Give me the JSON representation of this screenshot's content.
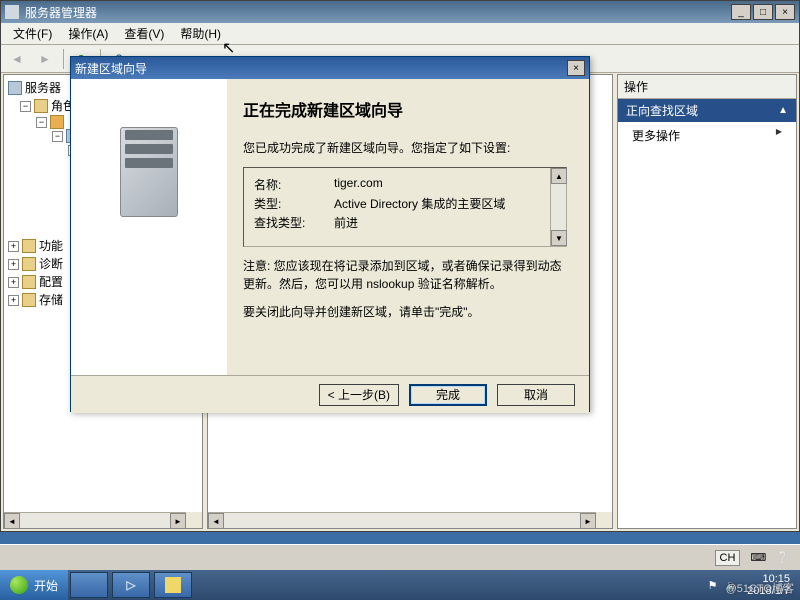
{
  "main_window": {
    "title": "服务器管理器"
  },
  "menubar": {
    "file": "文件(F)",
    "action": "操作(A)",
    "view": "查看(V)",
    "help": "帮助(H)"
  },
  "tree": {
    "root": "服务器",
    "roles": "角色",
    "features": "功能",
    "diagnostics": "诊断",
    "configuration": "配置",
    "storage": "存储"
  },
  "actions_pane": {
    "header": "操作",
    "section": "正向查找区域",
    "more_actions": "更多操作"
  },
  "dialog": {
    "title": "新建区域向导",
    "heading": "正在完成新建区域向导",
    "intro": "您已成功完成了新建区域向导。您指定了如下设置:",
    "settings": {
      "name_label": "名称:",
      "name_value": "tiger.com",
      "type_label": "类型:",
      "type_value": "Active Directory 集成的主要区域",
      "lookup_label": "查找类型:",
      "lookup_value": "前进"
    },
    "note": "注意: 您应该现在将记录添加到区域，或者确保记录得到动态更新。然后，您可以用 nslookup 验证名称解析。",
    "closing": "要关闭此向导并创建新区域，请单击\"完成\"。",
    "buttons": {
      "back": "< 上一步(B)",
      "finish": "完成",
      "cancel": "取消"
    }
  },
  "tray": {
    "ime": "CH"
  },
  "taskbar": {
    "start": "开始",
    "time": "10:15",
    "date": "2018/1/7"
  },
  "watermark": "@51CTO博客"
}
